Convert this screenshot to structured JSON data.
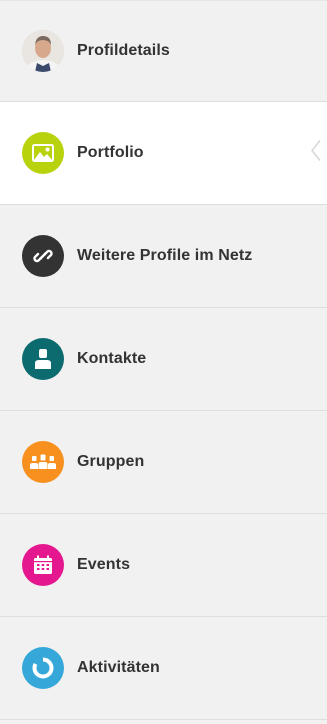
{
  "menu": {
    "items": [
      {
        "label": "Profildetails",
        "icon": "profile-photo-avatar"
      },
      {
        "label": "Portfolio",
        "icon": "image-icon",
        "color": "#b9d20e",
        "active": true
      },
      {
        "label": "Weitere Profile im Netz",
        "icon": "link-icon",
        "color": "#333333"
      },
      {
        "label": "Kontakte",
        "icon": "contact-person-icon",
        "color": "#0b6b6f"
      },
      {
        "label": "Gruppen",
        "icon": "group-icon",
        "color": "#f7901e"
      },
      {
        "label": "Events",
        "icon": "calendar-icon",
        "color": "#e5178f"
      },
      {
        "label": "Aktivitäten",
        "icon": "activity-ring-icon",
        "color": "#35a8d9"
      }
    ]
  }
}
